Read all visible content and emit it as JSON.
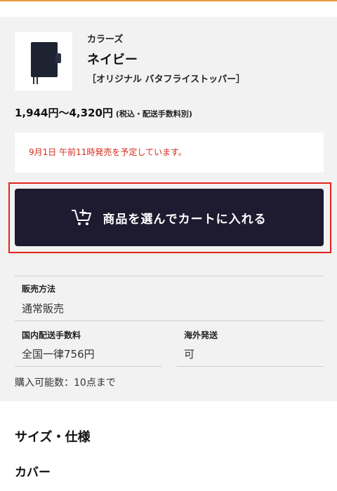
{
  "product": {
    "brand": "カラーズ",
    "color": "ネイビー",
    "variant": "［オリジナル バタフライストッパー］"
  },
  "price": {
    "range": "1,944円〜4,320円",
    "note": "(税込・配送手数料別)"
  },
  "notice": "9月1日 午前11時発売を予定しています。",
  "cart_button": {
    "label": "商品を選んでカートに入れる",
    "icon": "cart-plus-icon"
  },
  "info": {
    "sales_method_label": "販売方法",
    "sales_method_value": "通常販売",
    "domestic_shipping_label": "国内配送手数料",
    "domestic_shipping_value": "全国一律756円",
    "overseas_shipping_label": "海外発送",
    "overseas_shipping_value": "可",
    "purchase_limit": "購入可能数：10点まで"
  },
  "sections": {
    "size_spec": "サイズ・仕様",
    "cover": "カバー"
  },
  "colors": {
    "accent_top": "#e8973a",
    "button_bg": "#1e1a30",
    "notice_text": "#d52a1a",
    "highlight_border": "#e2241b"
  }
}
